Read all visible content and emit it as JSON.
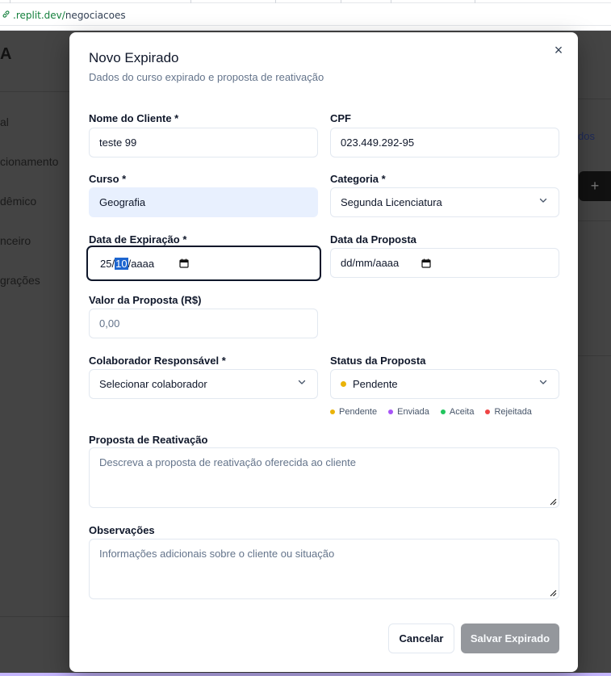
{
  "browser": {
    "url_host": ".replit.dev/",
    "url_path": "negociacoes"
  },
  "background_app": {
    "logo": "A",
    "sidebar_items": [
      "al",
      "cionamento",
      "dêmico",
      "nceiro",
      "grações"
    ],
    "right_link": "dos",
    "right_button": "+"
  },
  "modal": {
    "title": "Novo Expirado",
    "subtitle": "Dados do curso expirado e proposta de reativação",
    "close_symbol": "×",
    "fields": {
      "client_name": {
        "label": "Nome do Cliente *",
        "value": "teste 99"
      },
      "cpf": {
        "label": "CPF",
        "value": "023.449.292-95"
      },
      "course": {
        "label": "Curso *",
        "value": "Geografia"
      },
      "category": {
        "label": "Categoria *",
        "value": "Segunda Licenciatura"
      },
      "expiration_date": {
        "label": "Data de Expiração *",
        "day": "25",
        "sep1": "/",
        "month": "10",
        "sep2": "/",
        "year": "aaaa"
      },
      "proposal_date": {
        "label": "Data da Proposta",
        "placeholder": "dd/mm/aaaa"
      },
      "proposal_value": {
        "label": "Valor da Proposta (R$)",
        "placeholder": "0,00"
      },
      "collaborator": {
        "label": "Colaborador Responsável *",
        "value": "Selecionar colaborador"
      },
      "proposal_status": {
        "label": "Status da Proposta",
        "value": "Pendente",
        "dot_color": "#eab308"
      },
      "reactivation_proposal": {
        "label": "Proposta de Reativação",
        "placeholder": "Descreva a proposta de reativação oferecida ao cliente"
      },
      "observations": {
        "label": "Observações",
        "placeholder": "Informações adicionais sobre o cliente ou situação"
      }
    },
    "status_legend": [
      {
        "label": "Pendente",
        "color": "#eab308"
      },
      {
        "label": "Enviada",
        "color": "#a855f7"
      },
      {
        "label": "Aceita",
        "color": "#22c55e"
      },
      {
        "label": "Rejeitada",
        "color": "#ef4444"
      }
    ],
    "buttons": {
      "cancel": "Cancelar",
      "save": "Salvar Expirado"
    }
  }
}
